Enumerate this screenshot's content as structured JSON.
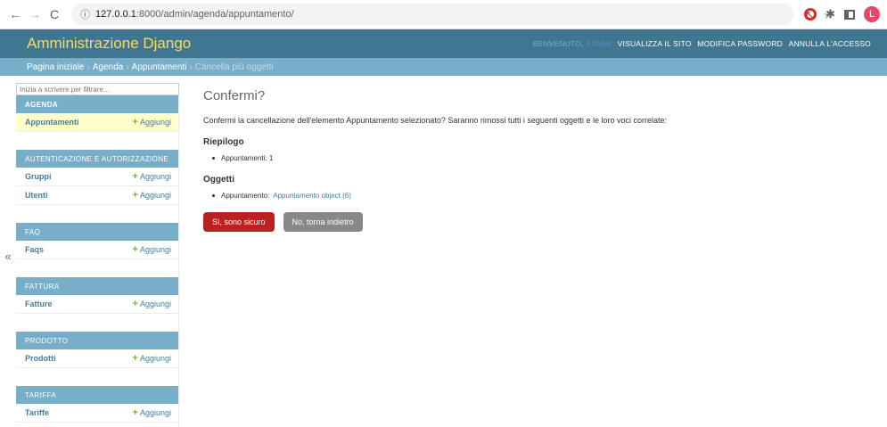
{
  "browser": {
    "url_host": "127.0.0.1",
    "url_path": ":8000/admin/agenda/appuntamento/",
    "profile_initial": "L"
  },
  "header": {
    "branding": "Amministrazione Django",
    "welcome": "BENVENUTO,",
    "username": "ADMIN",
    "links": [
      "VISUALIZZA IL SITO",
      "MODIFICA PASSWORD",
      "ANNULLA L'ACCESSO"
    ]
  },
  "breadcrumbs": {
    "home": "Pagina iniziale",
    "app": "Agenda",
    "model": "Appuntamenti",
    "current": "Cancella più oggetti"
  },
  "sidebar": {
    "filter_placeholder": "Inizia a scrivere per filtrare...",
    "add_label": "Aggiungi",
    "modules": [
      {
        "caption": "AGENDA",
        "models": [
          "Appuntamenti"
        ]
      },
      {
        "caption": "AUTENTICAZIONE E AUTORIZZAZIONE",
        "models": [
          "Gruppi",
          "Utenti"
        ]
      },
      {
        "caption": "FAQ",
        "models": [
          "Faqs"
        ]
      },
      {
        "caption": "FATTURA",
        "models": [
          "Fatture"
        ]
      },
      {
        "caption": "PRODOTTO",
        "models": [
          "Prodotti"
        ]
      },
      {
        "caption": "TARIFFA",
        "models": [
          "Tariffe"
        ]
      }
    ]
  },
  "content": {
    "title": "Confermi?",
    "message": "Confermi la cancellazione dell'elemento Appuntamento selezionato? Saranno rimossi tutti i seguenti oggetti e le loro voci correlate:",
    "summary_title": "Riepilogo",
    "summary_item": "Appuntamenti: 1",
    "objects_title": "Oggetti",
    "object_prefix": "Appuntamento:",
    "object_link": "Appuntamento object (6)",
    "confirm_button": "Sì, sono sicuro",
    "cancel_button": "No, torna indietro"
  },
  "toggle_nav": "«"
}
